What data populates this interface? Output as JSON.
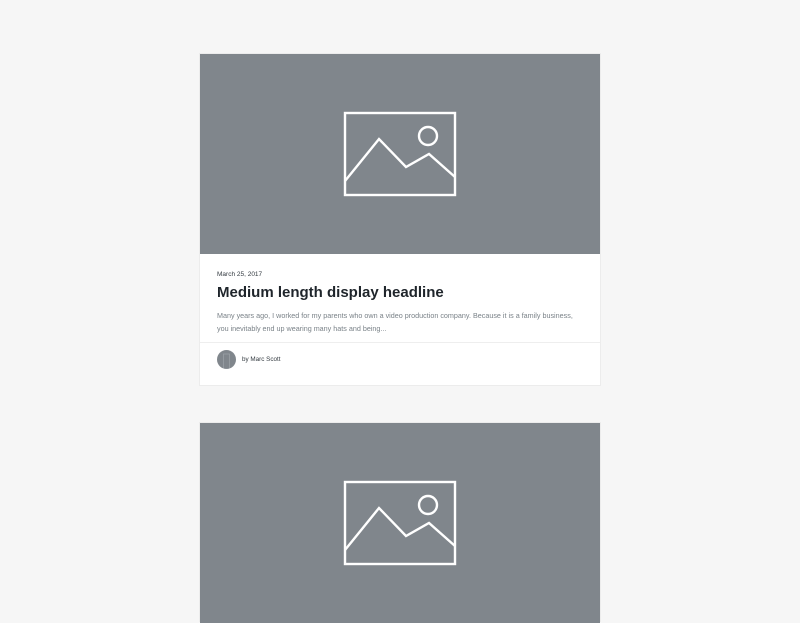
{
  "posts": [
    {
      "image_icon": "image-placeholder-icon",
      "date": "March 25, 2017",
      "headline": "Medium length display headline",
      "excerpt": "Many years ago, I worked for my parents who own a video production company. Because it is a family business, you inevitably end up wearing many hats and being...",
      "author": "by Marc Scott"
    },
    {
      "image_icon": "image-placeholder-icon"
    }
  ],
  "colors": {
    "background": "#f6f6f6",
    "placeholder": "#80868c",
    "card": "#ffffff",
    "headline": "#1f252b",
    "excerpt": "#7a8288"
  }
}
